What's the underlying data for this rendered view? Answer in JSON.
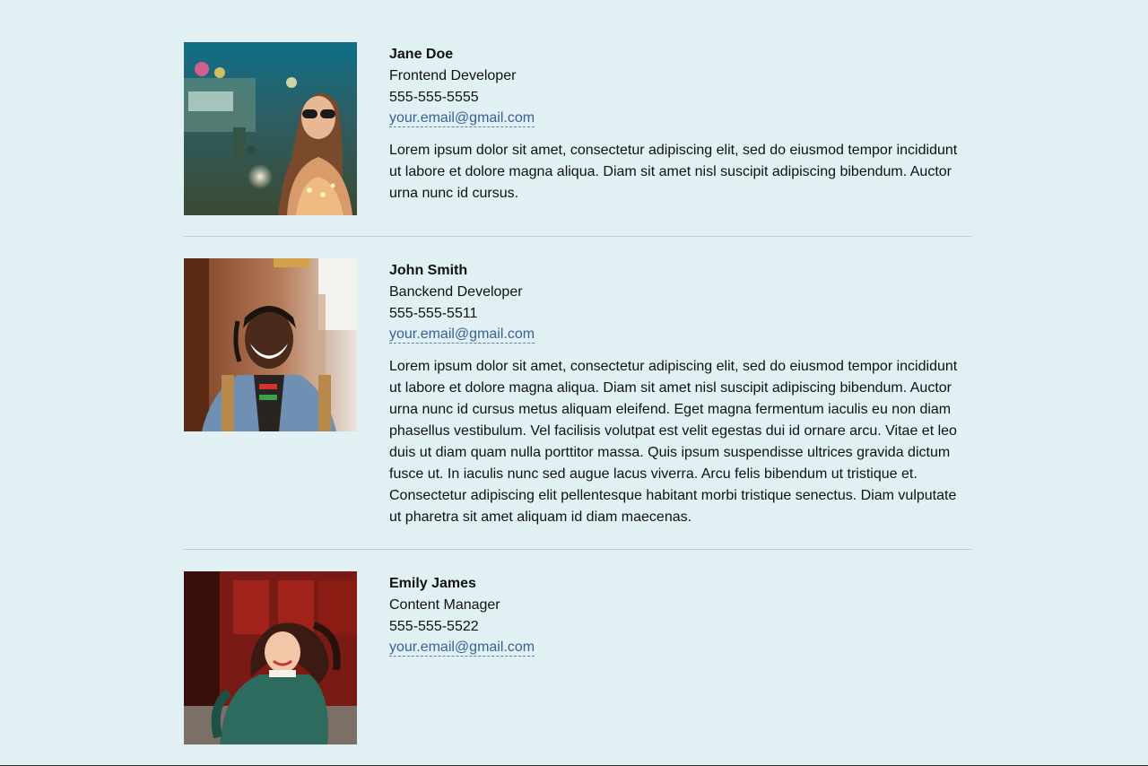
{
  "people": [
    {
      "name": "Jane Doe",
      "role": "Frontend Developer",
      "phone": "555-555-5555",
      "email": "your.email@gmail.com",
      "bio": "Lorem ipsum dolor sit amet, consectetur adipiscing elit, sed do eiusmod tempor incididunt ut labore et dolore magna aliqua. Diam sit amet nisl suscipit adipiscing bibendum. Auctor urna nunc id cursus."
    },
    {
      "name": "John Smith",
      "role": "Banckend Developer",
      "phone": "555-555-5511",
      "email": "your.email@gmail.com",
      "bio": "Lorem ipsum dolor sit amet, consectetur adipiscing elit, sed do eiusmod tempor incididunt ut labore et dolore magna aliqua. Diam sit amet nisl suscipit adipiscing bibendum. Auctor urna nunc id cursus metus aliquam eleifend. Eget magna fermentum iaculis eu non diam phasellus vestibulum. Vel facilisis volutpat est velit egestas dui id ornare arcu. Vitae et leo duis ut diam quam nulla porttitor massa. Quis ipsum suspendisse ultrices gravida dictum fusce ut. In iaculis nunc sed augue lacus viverra. Arcu felis bibendum ut tristique et. Consectetur adipiscing elit pellentesque habitant morbi tristique senectus. Diam vulputate ut pharetra sit amet aliquam id diam maecenas."
    },
    {
      "name": "Emily James",
      "role": "Content Manager",
      "phone": "555-555-5522",
      "email": "your.email@gmail.com"
    }
  ],
  "colors": {
    "background": "#e1f0f2",
    "link": "#3a5f9a",
    "divider": "#c8cfcf"
  }
}
